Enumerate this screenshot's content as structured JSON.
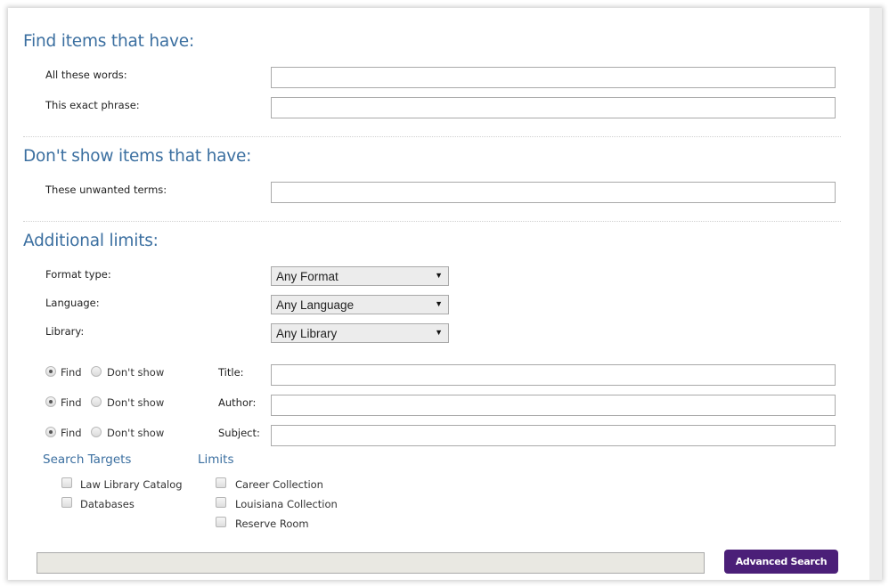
{
  "find_section": {
    "heading": "Find items that have:",
    "fields": [
      {
        "label": "All these words:",
        "value": ""
      },
      {
        "label": "This exact phrase:",
        "value": ""
      }
    ]
  },
  "exclude_section": {
    "heading": "Don't show items that have:",
    "fields": [
      {
        "label": "These unwanted terms:",
        "value": ""
      }
    ]
  },
  "limits_section": {
    "heading": "Additional limits:",
    "selects": [
      {
        "label": "Format type:",
        "value": "Any Format"
      },
      {
        "label": "Language:",
        "value": "Any Language"
      },
      {
        "label": "Library:",
        "value": "Any Library"
      }
    ],
    "field_rows": [
      {
        "find_label": "Find",
        "dont_label": "Don't show",
        "selected": "find",
        "label": "Title:",
        "value": ""
      },
      {
        "find_label": "Find",
        "dont_label": "Don't show",
        "selected": "find",
        "label": "Author:",
        "value": ""
      },
      {
        "find_label": "Find",
        "dont_label": "Don't show",
        "selected": "find",
        "label": "Subject:",
        "value": ""
      }
    ]
  },
  "search_targets": {
    "heading": "Search Targets",
    "items": [
      {
        "label": "Law Library Catalog",
        "checked": false
      },
      {
        "label": "Databases",
        "checked": false
      }
    ]
  },
  "limits": {
    "heading": "Limits",
    "items": [
      {
        "label": "Career Collection",
        "checked": false
      },
      {
        "label": "Louisiana Collection",
        "checked": false
      },
      {
        "label": "Reserve Room",
        "checked": false
      }
    ]
  },
  "footer": {
    "search_button": "Advanced Search"
  },
  "colors": {
    "heading": "#3b6fa0",
    "button": "#4b1f78"
  },
  "icons": {
    "dropdown": "triangle-down-icon"
  }
}
